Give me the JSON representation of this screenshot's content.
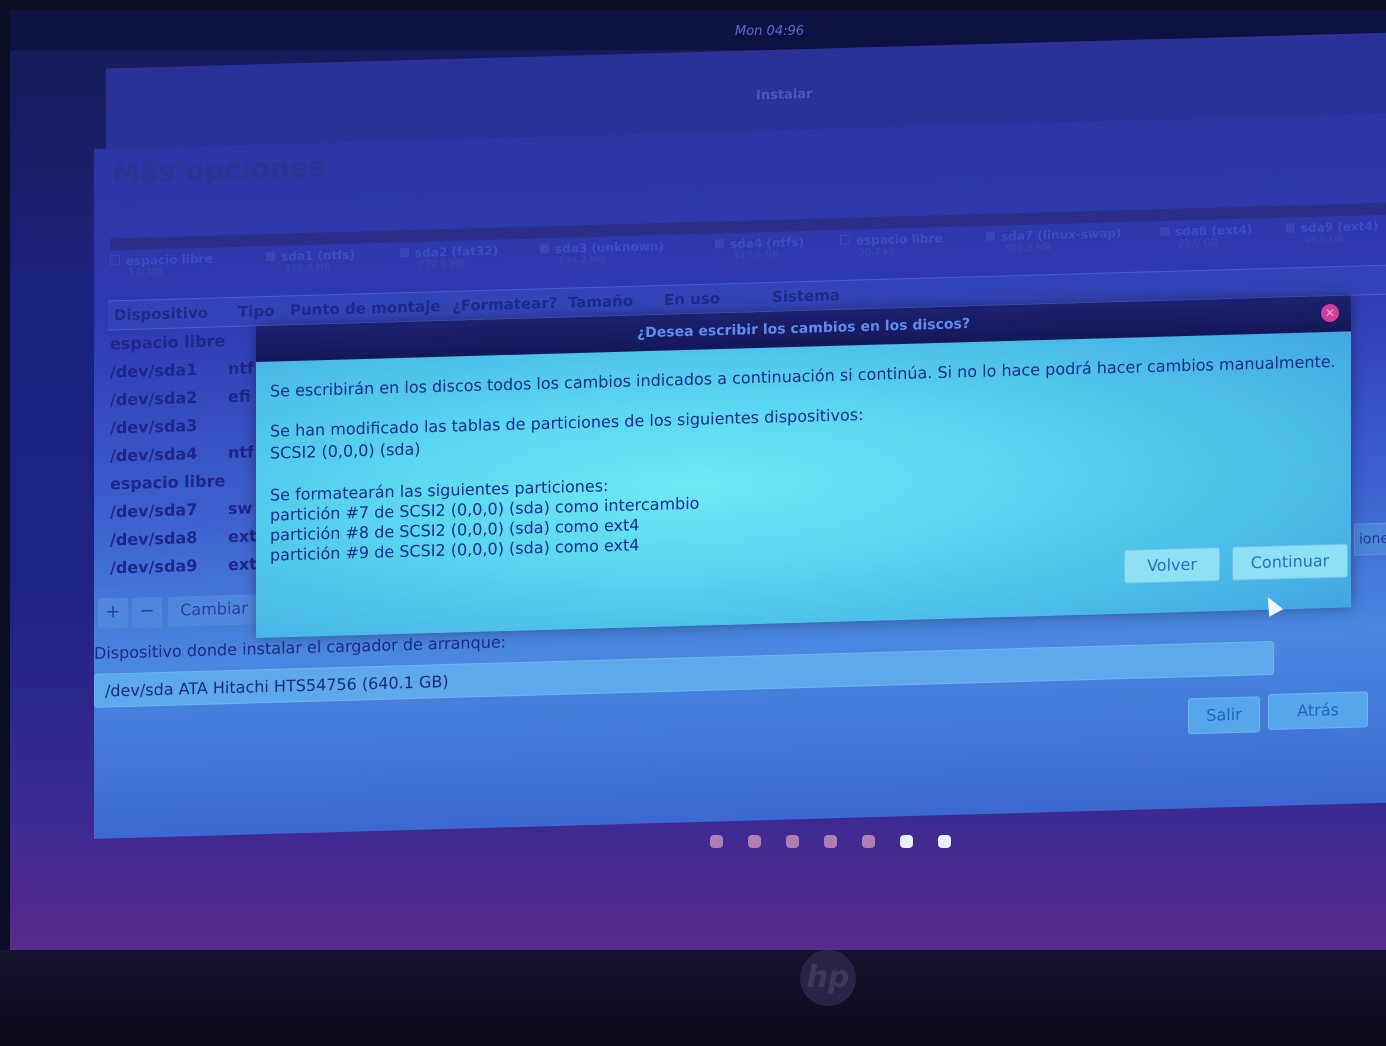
{
  "topbar": {
    "clock": "Mon 04:96"
  },
  "installer": {
    "title": "Instalar",
    "heading": "Más opciones",
    "legend": [
      {
        "name": "espacio libre",
        "size": "1.0 MB"
      },
      {
        "name": "sda1 (ntfs)",
        "size": "419.4 MB"
      },
      {
        "name": "sda2 (fat32)",
        "size": "272.6 MB"
      },
      {
        "name": "sda3 (unknown)",
        "size": "134.2 MB"
      },
      {
        "name": "sda4 (ntfs)",
        "size": "547.5 GB"
      },
      {
        "name": "espacio libre",
        "size": "30.7 kB"
      },
      {
        "name": "sda7 (linux-swap)",
        "size": "500.2 MB"
      },
      {
        "name": "sda8 (ext4)",
        "size": "23.0 GB"
      },
      {
        "name": "sda9 (ext4)",
        "size": "49.0 GB"
      }
    ],
    "columns": [
      "Dispositivo",
      "Tipo",
      "Punto de montaje",
      "¿Formatear?",
      "Tamaño",
      "En uso",
      "Sistema"
    ],
    "rows": [
      {
        "device": "espacio libre",
        "type": ""
      },
      {
        "device": "/dev/sda1",
        "type": "ntf"
      },
      {
        "device": "/dev/sda2",
        "type": "efi"
      },
      {
        "device": "/dev/sda3",
        "type": ""
      },
      {
        "device": "/dev/sda4",
        "type": "ntf"
      },
      {
        "device": "espacio libre",
        "type": ""
      },
      {
        "device": "/dev/sda7",
        "type": "sw"
      },
      {
        "device": "/dev/sda8",
        "type": "ext"
      },
      {
        "device": "/dev/sda9",
        "type": "ext"
      }
    ],
    "toolbar": {
      "add": "+",
      "remove": "−",
      "change": "Cambiar"
    },
    "options_button": "iones...",
    "boot_label": "Dispositivo donde instalar el cargador de arranque:",
    "boot_device": "/dev/sda   ATA Hitachi HTS54756 (640.1 GB)",
    "buttons": {
      "quit": "Salir",
      "back": "Atrás"
    }
  },
  "dialog": {
    "title": "¿Desea escribir los cambios en los discos?",
    "line1": "Se escribirán en los discos todos los cambios indicados a continuación si continúa. Si no lo hace podrá hacer cambios manualmente.",
    "line2": "Se han modificado las tablas de particiones de los siguientes dispositivos:",
    "line3": "SCSI2 (0,0,0) (sda)",
    "line4": "Se formatearán las siguientes particiones:",
    "line5": "partición #7 de SCSI2 (0,0,0) (sda) como intercambio",
    "line6": "partición #8 de SCSI2 (0,0,0) (sda) como ext4",
    "line7": "partición #9 de SCSI2 (0,0,0) (sda) como ext4",
    "back_button": "Volver",
    "continue_button": "Continuar"
  },
  "progress": {
    "total_steps": 7,
    "active_steps": 2
  },
  "brand": {
    "logo": "hp"
  }
}
